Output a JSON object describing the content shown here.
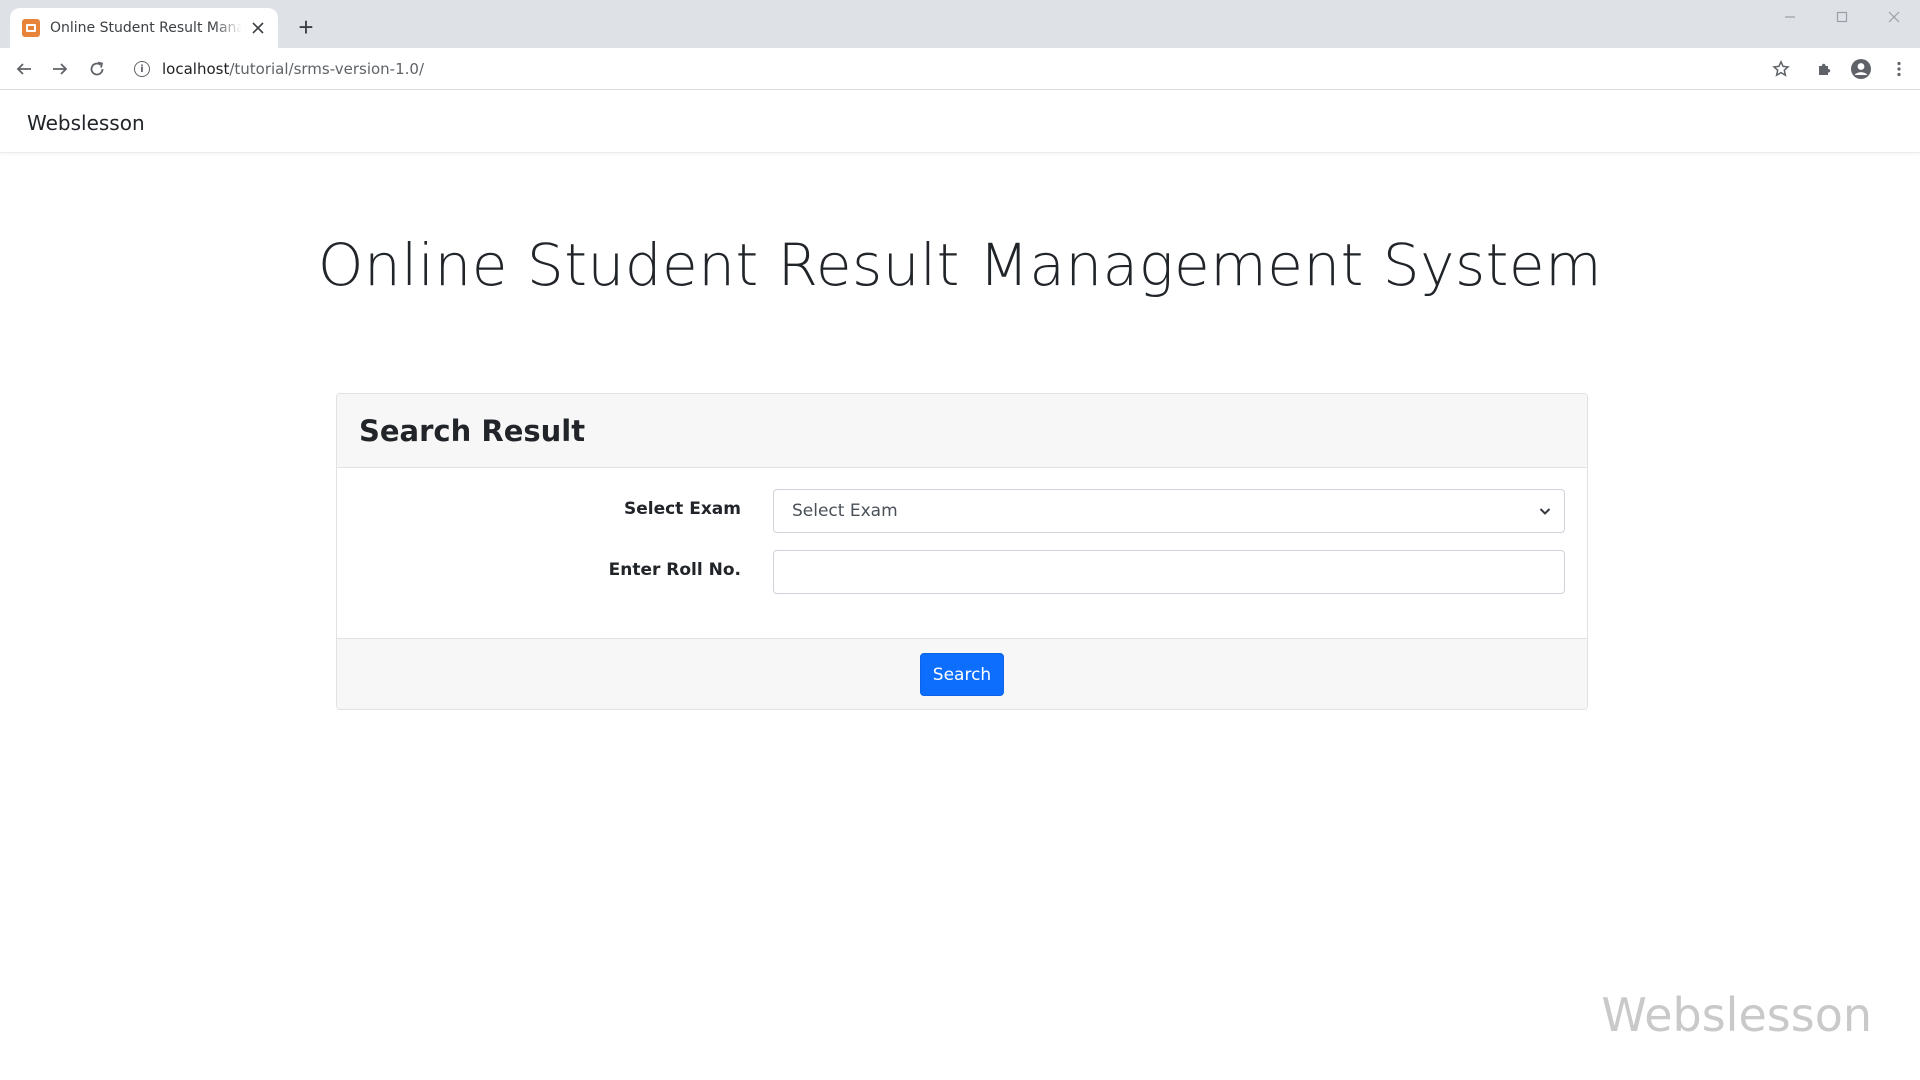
{
  "browser": {
    "tab_title": "Online Student Result Management System",
    "url_host": "localhost",
    "url_path": "/tutorial/srms-version-1.0/",
    "new_tab_symbol": "+",
    "favicon_color": "#e8833a"
  },
  "navbar": {
    "brand": "Webslesson"
  },
  "main": {
    "title": "Online Student Result Management System"
  },
  "search_card": {
    "header": "Search Result",
    "exam_label": "Select Exam",
    "exam_select_value": "Select Exam",
    "roll_label": "Enter Roll No.",
    "roll_value": "",
    "search_button": "Search",
    "button_color": "#0d6efd"
  },
  "watermark": {
    "text": "Webslesson"
  }
}
